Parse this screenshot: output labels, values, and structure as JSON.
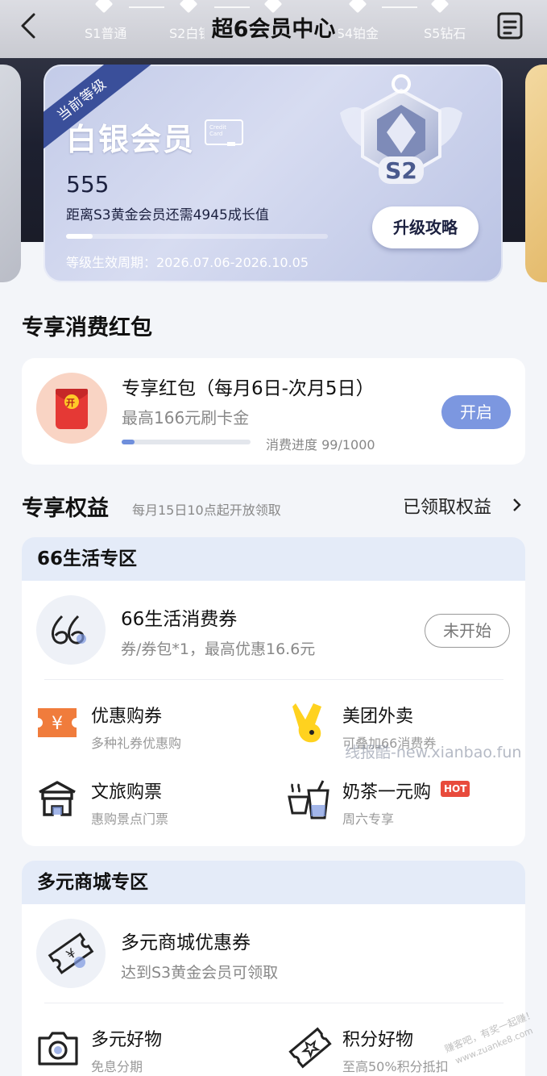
{
  "header": {
    "title": "超6会员中心"
  },
  "levels": [
    "S1普通",
    "S2白银",
    "S4铂金",
    "S5钻石"
  ],
  "member_card": {
    "ribbon": "当前等级",
    "level_name": "白银会员",
    "credit_card_text": "Credit Card",
    "points": "555",
    "next_level_text": "距离S3黄金会员还需4945成长值",
    "progress": 0.1,
    "period": "等级生效周期：2026.07.06-2026.10.05",
    "upgrade_button": "升级攻略",
    "badge_label": "S2"
  },
  "redpacket_section": {
    "title": "专享消费红包",
    "card_title": "专享红包（每月6日-次月5日）",
    "card_subtitle": "最高166元刷卡金",
    "progress_label": "消费进度 99/1000",
    "progress": 0.099,
    "open_button": "开启",
    "icon_char": "开"
  },
  "benefits_section": {
    "title": "专享权益",
    "subtitle": "每月15日10点起开放领取",
    "claimed_link": "已领取权益"
  },
  "life_zone": {
    "header": "66生活专区",
    "voucher_title": "66生活消费券",
    "voucher_subtitle": "券/券包*1，最高优惠16.6元",
    "voucher_status": "未开始",
    "grid": [
      {
        "title": "优惠购券",
        "subtitle": "多种礼券优惠购",
        "icon": "coupon-icon"
      },
      {
        "title": "美团外卖",
        "subtitle": "可叠加66消费券",
        "icon": "meituan-icon"
      },
      {
        "title": "文旅购票",
        "subtitle": "惠购景点门票",
        "icon": "ticket-building-icon"
      },
      {
        "title": "奶茶一元购",
        "subtitle": "周六专享",
        "icon": "milk-tea-icon",
        "tag": "HOT"
      }
    ]
  },
  "mall_zone": {
    "header": "多元商城专区",
    "voucher_title": "多元商城优惠券",
    "voucher_subtitle": "达到S3黄金会员可领取",
    "grid": [
      {
        "title": "多元好物",
        "subtitle": "免息分期",
        "icon": "camera-icon"
      },
      {
        "title": "积分好物",
        "subtitle": "至高50%积分抵扣",
        "icon": "points-ticket-icon"
      }
    ]
  },
  "watermarks": [
    "线报酷-new.xianbao.fun",
    "赚客吧，有奖一起赚！",
    "www.zuanke8.com"
  ],
  "colors": {
    "accent": "#6f8fdc",
    "hot": "#e84b3c",
    "panel_head": "#e4ebf8"
  }
}
